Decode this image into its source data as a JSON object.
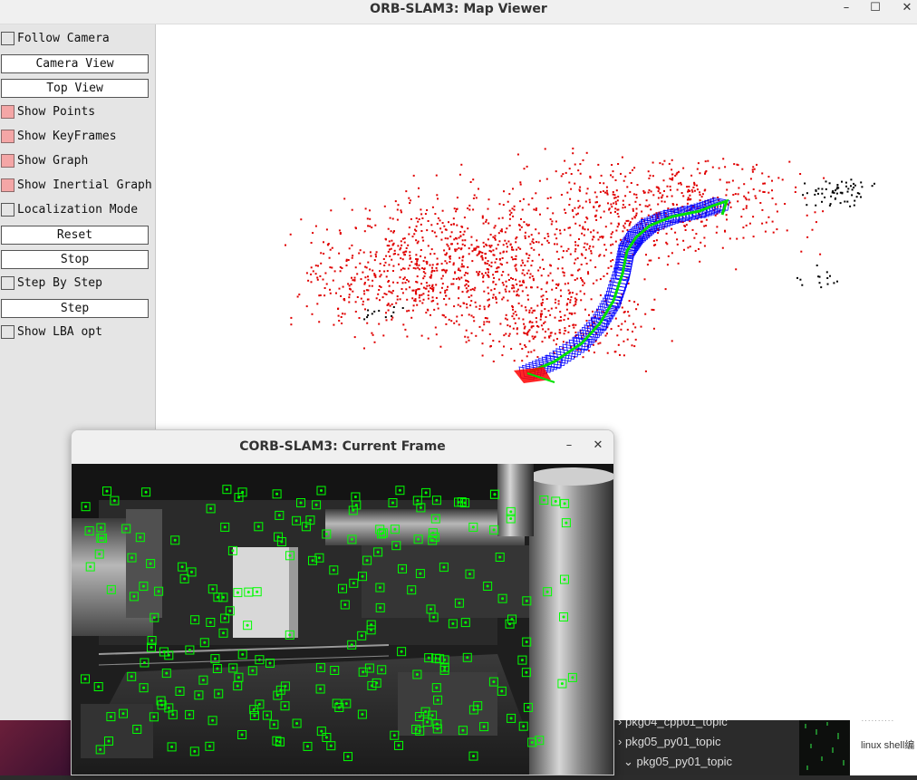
{
  "map_window": {
    "title": "ORB-SLAM3: Map Viewer",
    "controls": {
      "minimize": "–",
      "maximize": "☐",
      "close": "✕"
    }
  },
  "panel": {
    "items": [
      {
        "type": "checkbox",
        "label": "Follow Camera",
        "checked": false
      },
      {
        "type": "button",
        "label": "Camera View"
      },
      {
        "type": "button",
        "label": "Top View"
      },
      {
        "type": "checkbox",
        "label": "Show Points",
        "checked": true
      },
      {
        "type": "checkbox",
        "label": "Show KeyFrames",
        "checked": true
      },
      {
        "type": "checkbox",
        "label": "Show Graph",
        "checked": true
      },
      {
        "type": "checkbox",
        "label": "Show Inertial Graph",
        "checked": true
      },
      {
        "type": "checkbox",
        "label": "Localization Mode",
        "checked": false
      },
      {
        "type": "button",
        "label": "Reset"
      },
      {
        "type": "button",
        "label": "Stop"
      },
      {
        "type": "checkbox",
        "label": "Step By Step",
        "checked": false
      },
      {
        "type": "button",
        "label": "Step"
      },
      {
        "type": "checkbox",
        "label": "Show LBA opt",
        "checked": false
      }
    ]
  },
  "colors": {
    "map_point": "#e00000",
    "ref_point": "#000000",
    "keyframe": "#0000ff",
    "graph": "#00e000",
    "current_camera": "#ff0000",
    "feature_box": "#00ff00",
    "checked_box": "#f4a6a6"
  },
  "frame_window": {
    "title": "CORB-SLAM3: Current Frame",
    "controls": {
      "minimize": "–",
      "close": "✕"
    }
  },
  "background": {
    "tree_items": [
      "pkg04_cpp01_topic",
      "pkg05_py01_topic",
      "pkg05_py01_topic"
    ],
    "note_text": "linux shell编"
  }
}
